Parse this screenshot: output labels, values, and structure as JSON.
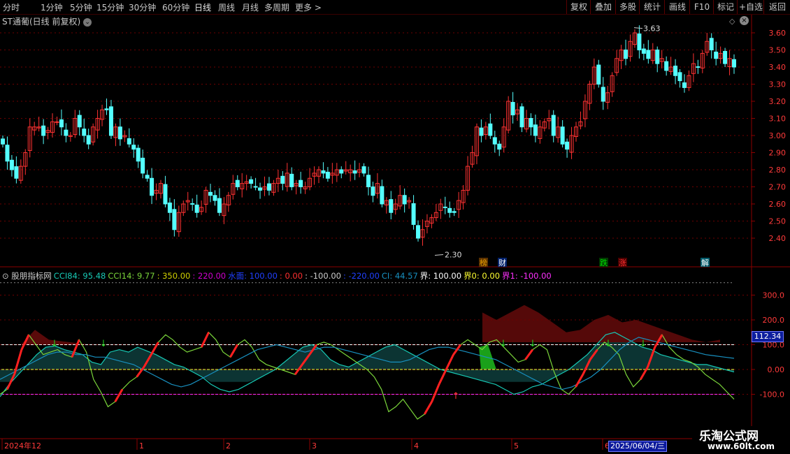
{
  "toolbar": {
    "periods": [
      "分时",
      "1分钟",
      "5分钟",
      "15分钟",
      "30分钟",
      "60分钟",
      "日线",
      "周线",
      "月线",
      "多周期",
      "更多 >"
    ],
    "active": "日线",
    "right": [
      "复权",
      "叠加",
      "多股",
      "统计",
      "画线",
      "F10",
      "标记",
      "+自选",
      "返回"
    ]
  },
  "title": "ST通葡(日线 前复权)",
  "price_axis": [
    "3.60",
    "3.50",
    "3.40",
    "3.30",
    "3.20",
    "3.10",
    "3.00",
    "2.90",
    "2.80",
    "2.70",
    "2.60",
    "2.50",
    "2.40"
  ],
  "annotations": {
    "high": "3.63",
    "low": "2.30"
  },
  "event_tags": [
    {
      "text": "榜",
      "color": "#e8a000",
      "bg": "#5a3000"
    },
    {
      "text": "财",
      "color": "#ffffff",
      "bg": "#00206a"
    },
    {
      "text": "跌",
      "color": "#00e000",
      "bg": "#003a00"
    },
    {
      "text": "涨",
      "color": "#ff3030",
      "bg": "#4a0000"
    },
    {
      "text": "解",
      "color": "#ffffff",
      "bg": "#005a6a"
    }
  ],
  "indicator": {
    "name": "股朋指标网",
    "items": [
      {
        "text": "CCI84: 95.48",
        "color": "#17c8b4"
      },
      {
        "text": "CCI14: 9.77",
        "color": "#7ad43a"
      },
      {
        "text": ": 350.00",
        "color": "#d0d000"
      },
      {
        "text": ": 220.00",
        "color": "#d000d0"
      },
      {
        "text": "水面: 100.00",
        "color": "#2040ff"
      },
      {
        "text": ": 0.00",
        "color": "#ff3030"
      },
      {
        "text": ": -100.00",
        "color": "#cccccc"
      },
      {
        "text": ": -220.00",
        "color": "#2040ff"
      },
      {
        "text": "CI: 44.57",
        "color": "#1890c0"
      },
      {
        "text": "界: 100.00",
        "color": "#ffffff"
      },
      {
        "text": "界0: 0.00",
        "color": "#ffff30"
      },
      {
        "text": "界1: -100.00",
        "color": "#ff30ff"
      }
    ],
    "axis": [
      "300.0",
      "200.0",
      "100.0",
      "0.00",
      "-100.0"
    ],
    "cursor_value": "112.34"
  },
  "time_axis": [
    "2024年12",
    "1",
    "2",
    "3",
    "4",
    "5",
    "6"
  ],
  "cursor_date": "2025/06/04/三",
  "watermark": {
    "cn": "乐淘公式网",
    "url": "www.60lt.com"
  },
  "colors": {
    "up": "#ff3232",
    "down": "#54ffff",
    "grid": "#6e0000",
    "axis": "#8b0000"
  },
  "chart_data": [
    {
      "type": "candlestick",
      "title": "ST通葡(日线 前复权)",
      "ylim": [
        2.3,
        3.65
      ],
      "y_ticks": [
        3.6,
        3.5,
        3.4,
        3.3,
        3.2,
        3.1,
        3.0,
        2.9,
        2.8,
        2.7,
        2.6,
        2.5,
        2.4
      ],
      "closes": [
        2.95,
        2.85,
        2.8,
        2.75,
        2.82,
        2.9,
        3.05,
        3.05,
        3.05,
        3.0,
        3.03,
        3.08,
        3.08,
        3.05,
        3.0,
        3.0,
        3.1,
        3.05,
        3.0,
        2.95,
        3.05,
        3.1,
        3.15,
        3.15,
        3.0,
        3.05,
        2.98,
        3.0,
        2.95,
        2.92,
        2.85,
        2.78,
        2.75,
        2.65,
        2.68,
        2.72,
        2.6,
        2.55,
        2.45,
        2.55,
        2.6,
        2.62,
        2.6,
        2.55,
        2.58,
        2.68,
        2.65,
        2.62,
        2.55,
        2.6,
        2.65,
        2.72,
        2.7,
        2.72,
        2.73,
        2.72,
        2.7,
        2.68,
        2.7,
        2.68,
        2.72,
        2.75,
        2.72,
        2.78,
        2.7,
        2.72,
        2.7,
        2.7,
        2.75,
        2.78,
        2.8,
        2.78,
        2.75,
        2.78,
        2.8,
        2.78,
        2.8,
        2.8,
        2.78,
        2.8,
        2.78,
        2.7,
        2.65,
        2.72,
        2.6,
        2.62,
        2.55,
        2.6,
        2.65,
        2.6,
        2.62,
        2.48,
        2.4,
        2.45,
        2.5,
        2.52,
        2.55,
        2.6,
        2.58,
        2.55,
        2.55,
        2.62,
        2.68,
        2.82,
        2.9,
        3.05,
        3.0,
        3.05,
        3.0,
        2.95,
        2.92,
        3.05,
        3.2,
        3.12,
        3.15,
        3.05,
        3.1,
        3.05,
        3.0,
        3.05,
        3.08,
        3.1,
        3.0,
        3.05,
        2.95,
        2.92,
        3.0,
        3.05,
        3.08,
        3.2,
        3.3,
        3.4,
        3.3,
        3.2,
        3.25,
        3.35,
        3.45,
        3.5,
        3.45,
        3.55,
        3.6,
        3.5,
        3.48,
        3.45,
        3.5,
        3.42,
        3.45,
        3.38,
        3.4,
        3.35,
        3.32,
        3.28,
        3.35,
        3.42,
        3.4,
        3.48,
        3.55,
        3.5,
        3.45,
        3.48,
        3.42,
        3.45,
        3.4
      ],
      "high_marker": 3.63,
      "low_marker": 2.3
    },
    {
      "type": "line",
      "title": "股朋指标网",
      "ylim": [
        -210,
        330
      ],
      "y_ticks": [
        300,
        200,
        100,
        0,
        -100
      ],
      "hlines": [
        {
          "name": "界",
          "y": 100,
          "color": "#ffffff"
        },
        {
          "name": "界0",
          "y": 0,
          "color": "#ffff30"
        },
        {
          "name": "界1",
          "y": -100,
          "color": "#ff30ff"
        }
      ],
      "series": [
        {
          "name": "CCI84",
          "color": "#17c8b4",
          "values": [
            -110,
            -60,
            -20,
            20,
            60,
            90,
            95,
            80,
            70,
            60,
            30,
            20,
            70,
            80,
            70,
            90,
            75,
            60,
            40,
            20,
            10,
            -10,
            -30,
            -60,
            -80,
            -90,
            -80,
            -60,
            -40,
            -20,
            0,
            30,
            60,
            90,
            100,
            80,
            40,
            20,
            10,
            30,
            50,
            70,
            90,
            100,
            80,
            60,
            40,
            20,
            0,
            -10,
            -20,
            -30,
            -40,
            -50,
            -60,
            -80,
            -100,
            -90,
            -70,
            -60,
            -40,
            -20,
            0,
            30,
            60,
            100,
            140,
            150,
            130,
            110,
            90,
            80,
            60,
            50,
            40,
            30,
            20,
            20,
            10,
            0,
            -10
          ]
        },
        {
          "name": "CCI14",
          "color": "#7ad43a",
          "values": [
            -100,
            -80,
            -20,
            80,
            140,
            100,
            60,
            70,
            80,
            60,
            50,
            120,
            70,
            -40,
            -90,
            -150,
            -130,
            -80,
            -50,
            -30,
            10,
            60,
            110,
            140,
            120,
            90,
            70,
            80,
            90,
            150,
            120,
            70,
            50,
            100,
            120,
            90,
            40,
            20,
            10,
            0,
            -10,
            -20,
            20,
            60,
            100,
            110,
            100,
            80,
            60,
            40,
            20,
            0,
            -30,
            -80,
            -170,
            -150,
            -120,
            -160,
            -200,
            -180,
            -130,
            -60,
            0,
            60,
            100,
            120,
            100,
            80,
            110,
            120,
            90,
            60,
            30,
            40,
            80,
            100,
            80,
            -10,
            -80,
            -100,
            -70,
            -20,
            40,
            80,
            110,
            90,
            60,
            -20,
            -70,
            -40,
            10,
            90,
            140,
            90,
            60,
            40,
            30,
            10,
            -20,
            -40,
            -60,
            -90,
            -120
          ]
        },
        {
          "name": "CI",
          "color": "#1890c0",
          "values": [
            -40,
            -20,
            0,
            20,
            40,
            60,
            70,
            70,
            60,
            60,
            50,
            50,
            40,
            30,
            20,
            0,
            -20,
            -40,
            -60,
            -70,
            -60,
            -40,
            -20,
            0,
            20,
            40,
            60,
            80,
            90,
            100,
            90,
            80,
            70,
            80,
            90,
            90,
            80,
            70,
            60,
            50,
            40,
            30,
            30,
            40,
            60,
            80,
            90,
            90,
            80,
            70,
            60,
            50,
            40,
            20,
            0,
            -20,
            -40,
            -60,
            -70,
            -80,
            -70,
            -50,
            -30,
            0,
            40,
            80,
            110,
            130,
            120,
            110,
            100,
            90,
            80,
            70,
            60,
            55,
            50,
            45
          ]
        }
      ]
    }
  ]
}
